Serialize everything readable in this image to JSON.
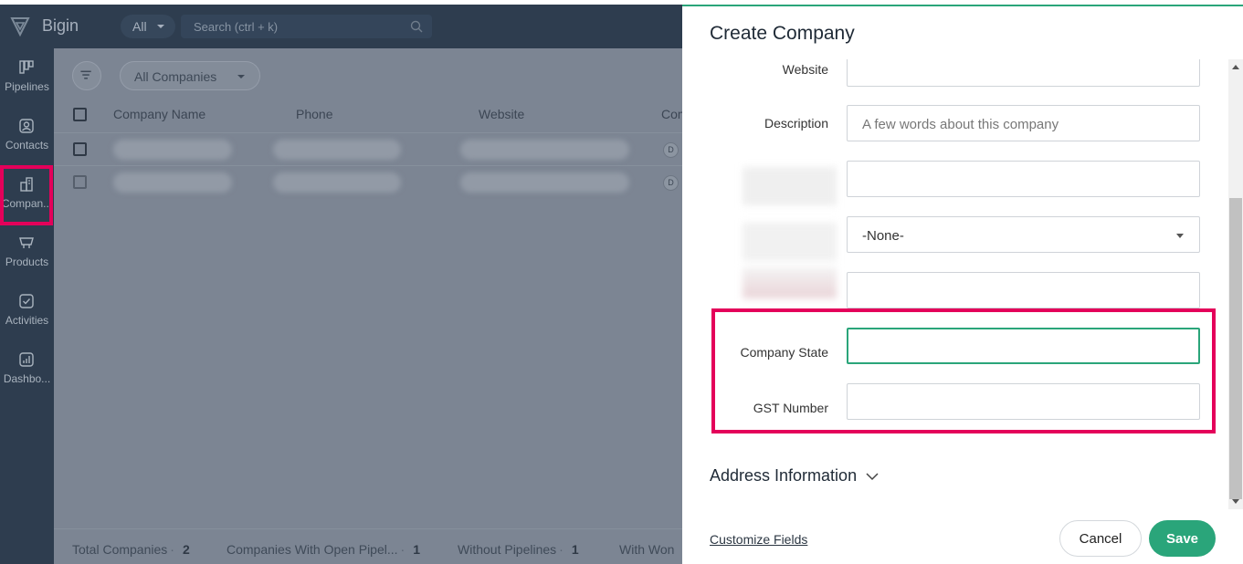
{
  "header": {
    "app_name": "Bigin",
    "scope": "All",
    "search_placeholder": "Search (ctrl + k)"
  },
  "sidebar": {
    "items": [
      {
        "label": "Pipelines",
        "icon": "pipelines-icon"
      },
      {
        "label": "Contacts",
        "icon": "contacts-icon"
      },
      {
        "label": "Compan...",
        "icon": "companies-icon"
      },
      {
        "label": "Products",
        "icon": "products-icon"
      },
      {
        "label": "Activities",
        "icon": "activities-icon"
      },
      {
        "label": "Dashbo...",
        "icon": "dashboards-icon"
      }
    ],
    "active_index": 2
  },
  "list_view": {
    "view_name": "All Companies",
    "columns": [
      "Company Name",
      "Phone",
      "Website",
      "Com"
    ],
    "rows": [
      {
        "avatar": "D"
      },
      {
        "avatar": "D"
      }
    ]
  },
  "footer_stats": [
    {
      "label": "Total Companies",
      "value": "2"
    },
    {
      "label": "Companies With Open Pipel...",
      "value": "1"
    },
    {
      "label": "Without Pipelines",
      "value": "1"
    },
    {
      "label": "With Won"
    }
  ],
  "panel": {
    "title": "Create Company",
    "fields": {
      "website": {
        "label": "Website",
        "value": ""
      },
      "description": {
        "label": "Description",
        "placeholder": "A few words about this company"
      },
      "blurred_1": {
        "value": ""
      },
      "blurred_2": {
        "selected": "-None-"
      },
      "blurred_3": {
        "value": ""
      },
      "company_state": {
        "label": "Company State",
        "value": ""
      },
      "gst_number": {
        "label": "GST Number",
        "value": ""
      }
    },
    "section": "Address Information",
    "customize_link": "Customize Fields",
    "cancel_label": "Cancel",
    "save_label": "Save"
  },
  "colors": {
    "accent": "#2aa57a",
    "highlight": "#e4005a",
    "sidebar_bg": "#2e3d4f"
  }
}
